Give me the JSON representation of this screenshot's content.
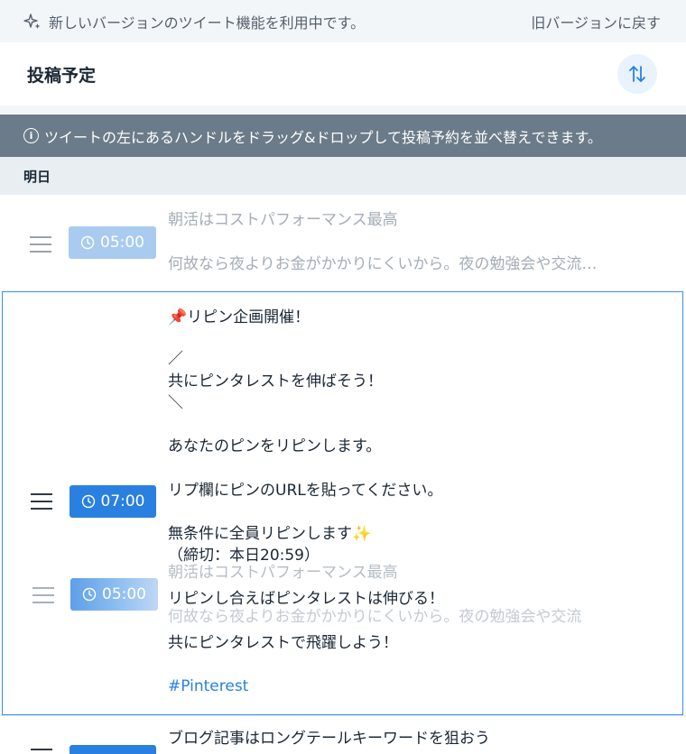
{
  "banner": {
    "message": "新しいバージョンのツイート機能を利用中です。",
    "revert_label": "旧バージョンに戻す"
  },
  "header": {
    "title": "投稿予定"
  },
  "info": {
    "message": "ツイートの左にあるハンドルをドラッグ&ドロップして投稿予約を並べ替えできます。"
  },
  "day_label": "明日",
  "posts": [
    {
      "time": "05:00",
      "line1": "朝活はコストパフォーマンス最高",
      "line2": "何故なら夜よりお金がかかりにくいから。夜の勉強会や交流…"
    },
    {
      "time": "07:00",
      "lines": [
        "📌リピン企画開催！",
        "／",
        "共にピンタレストを伸ばそう！",
        "＼",
        "あなたのピンをリピンします。",
        "リプ欄にピンのURLを貼ってください。",
        "無条件に全員リピンします✨",
        "（締切：本日20:59）",
        "リピンし合えばピンタレストは伸びる！",
        "共にピンタレストで飛躍しよう！",
        "#Pinterest"
      ]
    },
    {
      "line1": "ブログ記事はロングテールキーワードを狙おう"
    }
  ],
  "drag_ghost": {
    "time": "05:00",
    "line1": "朝活はコストパフォーマンス最高",
    "line2": "何故なら夜よりお金がかかりにくいから。夜の勉強会や交流"
  },
  "colors": {
    "accent": "#2980e0",
    "info_bar": "#6b7b8a",
    "day_header": "#e9eef3"
  }
}
